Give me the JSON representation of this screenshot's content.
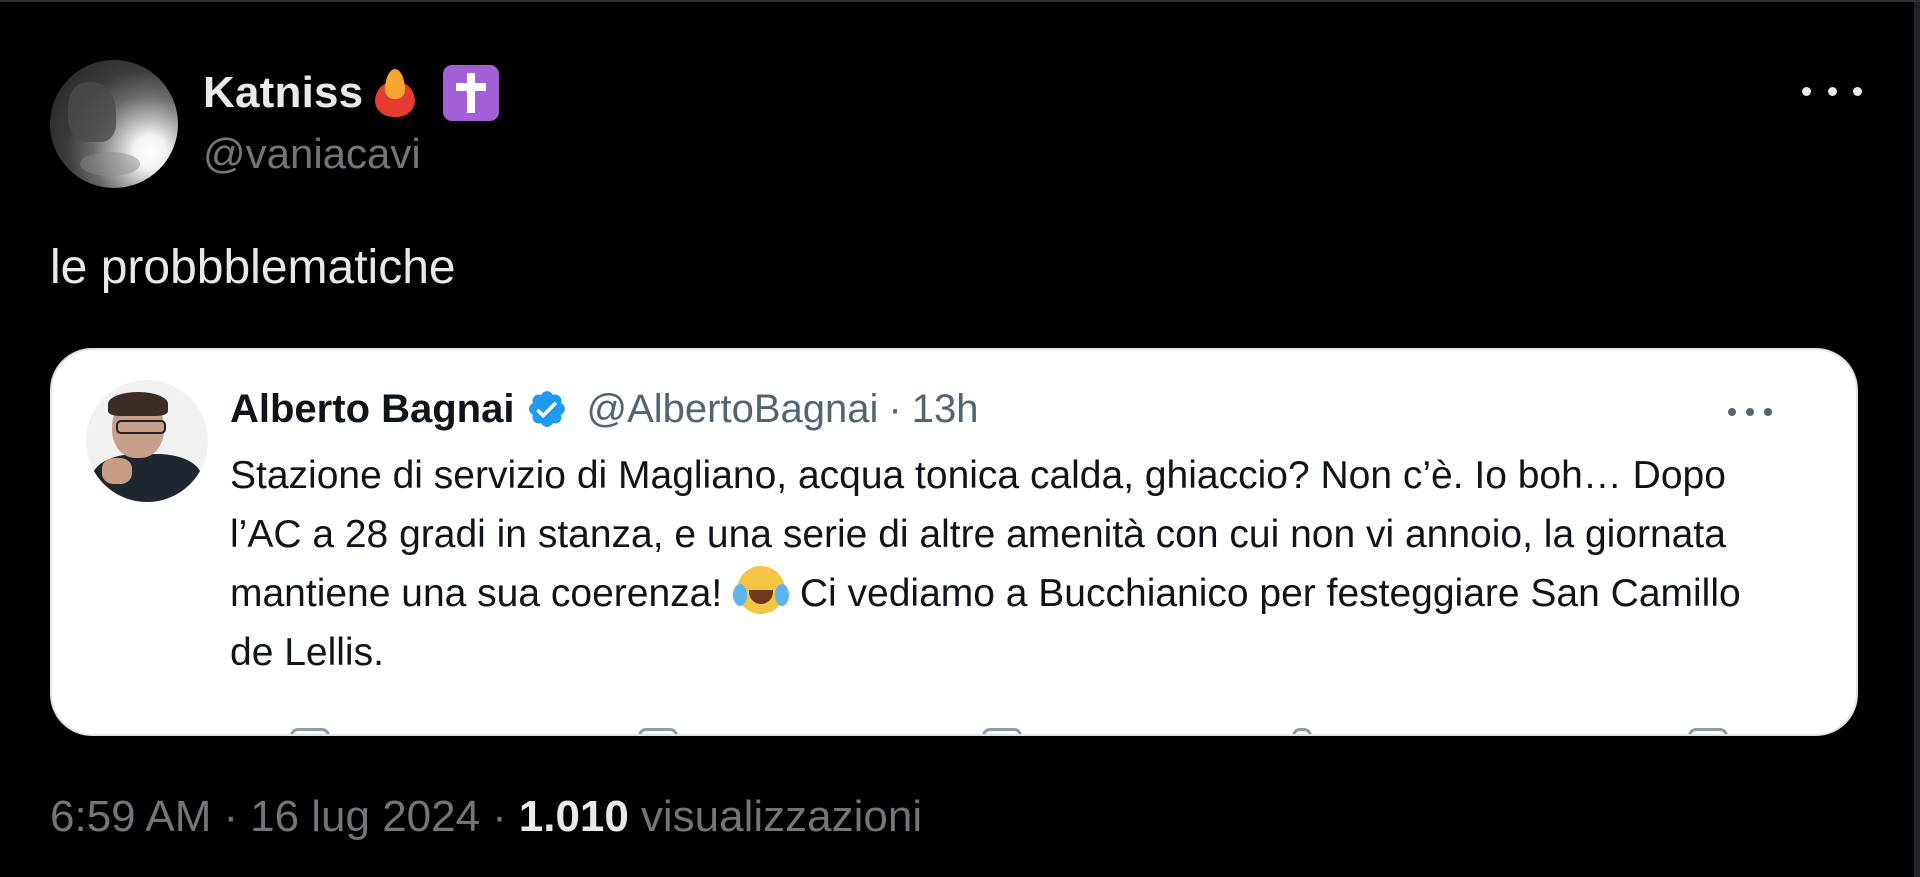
{
  "author": {
    "display_name": "Katniss",
    "handle": "@vaniacavi",
    "badges": [
      "fire-heart-emoji",
      "latin-cross-emoji"
    ]
  },
  "tweet": {
    "text": "le probbblematiche"
  },
  "quoted": {
    "name": "Alberto Bagnai",
    "handle": "@AlbertoBagnai",
    "separator": "·",
    "time": "13h",
    "text_before_emoji": "Stazione di servizio di Magliano, acqua tonica calda, ghiaccio? Non c’è. Io boh… Dopo l’AC a 28 gradi in stanza, e una serie di altre amenità con cui non vi annoio, la giornata mantiene una sua coerenza!",
    "emoji": "face-with-tears-of-joy",
    "text_after_emoji": "Ci vediamo a Bucchianico per festeggiare San Camillo de Lellis."
  },
  "meta": {
    "time": "6:59 AM",
    "sep1": "·",
    "date": "16 lug 2024",
    "sep2": "·",
    "views_count": "1.010",
    "views_label": "visualizzazioni"
  },
  "colors": {
    "background": "#000000",
    "text_primary": "#e7e9ea",
    "text_secondary": "#71767b",
    "quote_bg": "#ffffff",
    "verified_blue": "#1d9bf0",
    "badge_purple": "#a35fd6"
  },
  "icons": {
    "more": "more-horizontal-icon",
    "verified": "verified-badge-icon"
  }
}
